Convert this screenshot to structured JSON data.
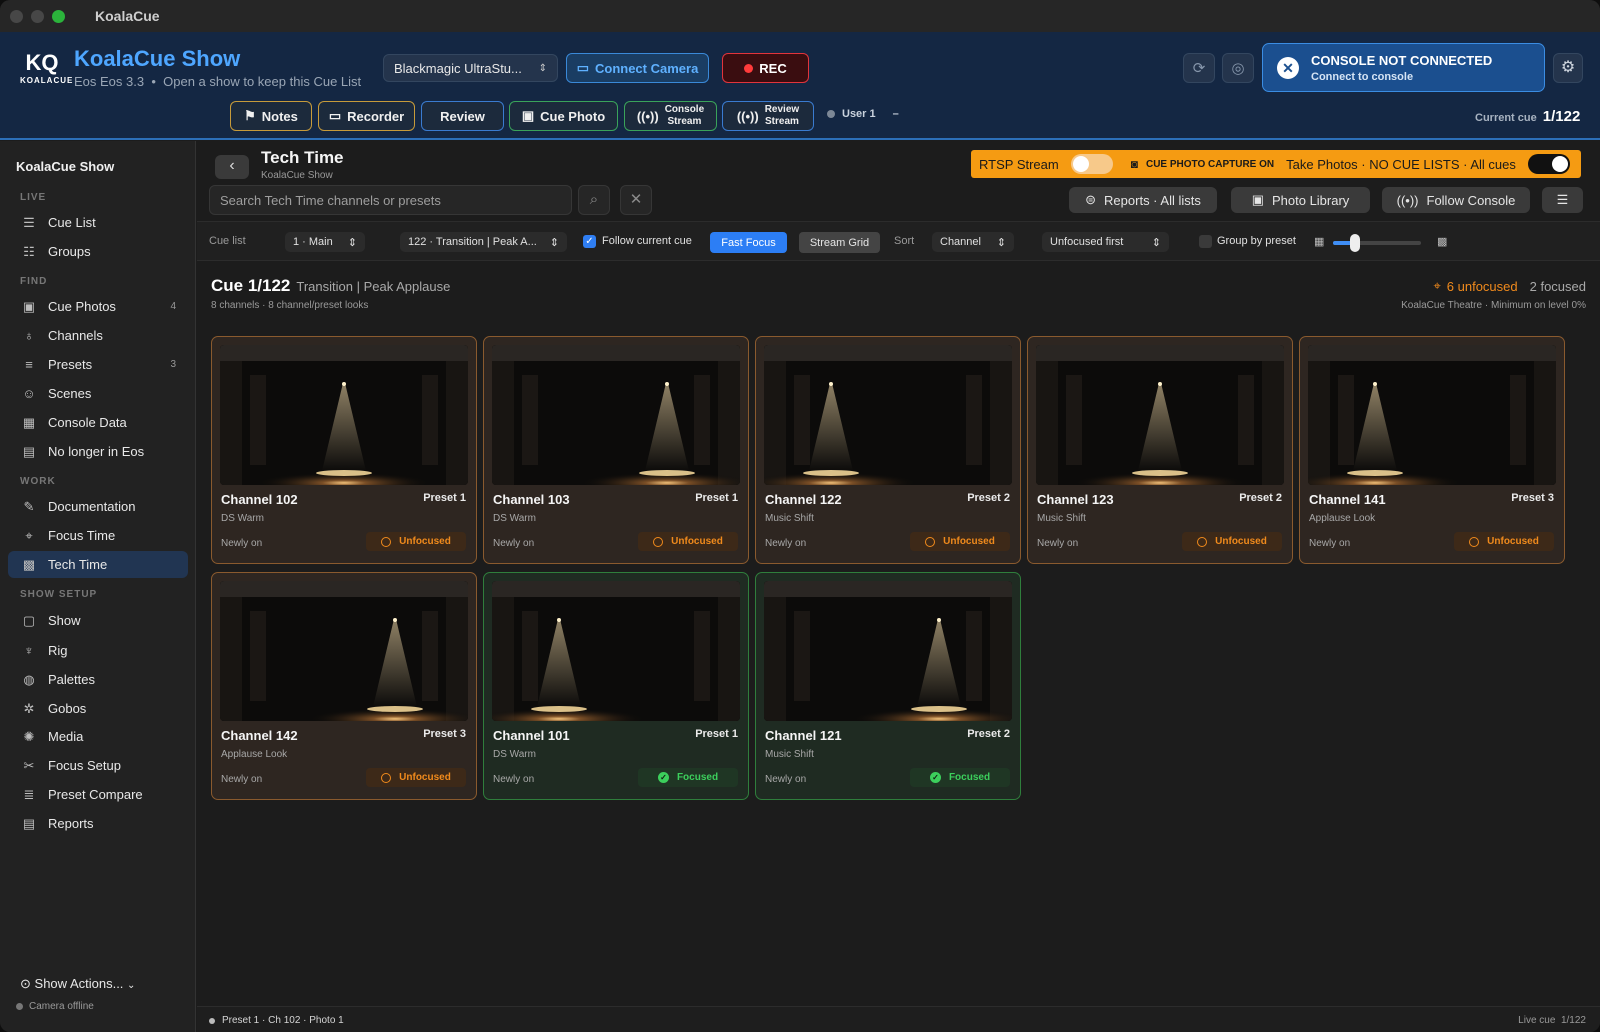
{
  "window": {
    "app_name": "KoalaCue"
  },
  "header": {
    "logo_text": "KQ",
    "logo_sub": "KOALACUE",
    "show_name": "KoalaCue Show",
    "subtitle_console": "Eos Eos 3.3",
    "subtitle_sep": "•",
    "subtitle_hint": "Open a show to keep this Cue List",
    "camera_select": "Blackmagic UltraStu...",
    "connect_camera": "Connect Camera",
    "rec": "REC",
    "console_title": "CONSOLE NOT CONNECTED",
    "console_sub": "Connect to console",
    "toolbar": {
      "notes": "Notes",
      "recorder": "Recorder",
      "review": "Review",
      "cue_photo": "Cue Photo",
      "console_stream_1": "Console",
      "console_stream_2": "Stream",
      "review_stream_1": "Review",
      "review_stream_2": "Stream"
    },
    "user": "User 1",
    "user_extra": "–",
    "current_cue_label": "Current cue",
    "current_cue_value": "1/122"
  },
  "sidebar": {
    "title": "KoalaCue Show",
    "sections": {
      "live": "LIVE",
      "find": "FIND",
      "work": "WORK",
      "show_setup": "SHOW SETUP"
    },
    "items": [
      {
        "label": "Cue List",
        "icon": "list-icon",
        "count": ""
      },
      {
        "label": "Groups",
        "icon": "people-icon",
        "count": ""
      },
      {
        "label": "Cue Photos",
        "icon": "photos-icon",
        "count": "4"
      },
      {
        "label": "Channels",
        "icon": "light-icon",
        "count": ""
      },
      {
        "label": "Presets",
        "icon": "sliders-icon",
        "count": "3"
      },
      {
        "label": "Scenes",
        "icon": "masks-icon",
        "count": ""
      },
      {
        "label": "Console Data",
        "icon": "table-icon",
        "count": ""
      },
      {
        "label": "No longer in Eos",
        "icon": "archive-icon",
        "count": ""
      },
      {
        "label": "Documentation",
        "icon": "edit-icon",
        "count": ""
      },
      {
        "label": "Focus Time",
        "icon": "crosshair-icon",
        "count": ""
      },
      {
        "label": "Tech Time",
        "icon": "grid-icon",
        "count": ""
      },
      {
        "label": "Show",
        "icon": "document-icon",
        "count": ""
      },
      {
        "label": "Rig",
        "icon": "lamp-icon",
        "count": ""
      },
      {
        "label": "Palettes",
        "icon": "palette-icon",
        "count": ""
      },
      {
        "label": "Gobos",
        "icon": "gobo-icon",
        "count": ""
      },
      {
        "label": "Media",
        "icon": "film-icon",
        "count": ""
      },
      {
        "label": "Focus Setup",
        "icon": "tools-icon",
        "count": ""
      },
      {
        "label": "Preset Compare",
        "icon": "compare-icon",
        "count": ""
      },
      {
        "label": "Reports",
        "icon": "report-icon",
        "count": ""
      }
    ],
    "show_actions": "Show Actions...",
    "camera_status": "Camera offline"
  },
  "page": {
    "title": "Tech Time",
    "subtitle": "KoalaCue Show",
    "rtsp_label": "RTSP Stream",
    "capture_label": "CUE PHOTO CAPTURE ON",
    "take_photos": "Take Photos · NO CUE LISTS · All cues",
    "search_placeholder": "Search Tech Time channels or presets",
    "reports_btn": "Reports · All lists",
    "photo_library": "Photo Library",
    "follow_console": "Follow Console"
  },
  "filters": {
    "cue_list_label": "Cue list",
    "cue_list_value": "1 · Main",
    "cue_value": "122 · Transition | Peak A...",
    "follow_current": "Follow current cue",
    "fast_focus": "Fast Focus",
    "stream_grid": "Stream Grid",
    "sort_label": "Sort",
    "sort_value": "Channel",
    "order_value": "Unfocused first",
    "group_by_preset": "Group by preset",
    "zoom_level": 0.25
  },
  "cue": {
    "title": "Cue 1/122",
    "name": "Transition | Peak Applause",
    "sub": "8 channels · 8 channel/preset looks",
    "unfocused": "6 unfocused",
    "focused": "2 focused",
    "venue": "KoalaCue Theatre · Minimum on level 0%"
  },
  "cards": [
    {
      "channel": "Channel 102",
      "preset": "Preset 1",
      "look": "DS Warm",
      "state": "Newly on",
      "status": "Unfocused",
      "focused": false
    },
    {
      "channel": "Channel 103",
      "preset": "Preset 1",
      "look": "DS Warm",
      "state": "Newly on",
      "status": "Unfocused",
      "focused": false
    },
    {
      "channel": "Channel 122",
      "preset": "Preset 2",
      "look": "Music Shift",
      "state": "Newly on",
      "status": "Unfocused",
      "focused": false
    },
    {
      "channel": "Channel 123",
      "preset": "Preset 2",
      "look": "Music Shift",
      "state": "Newly on",
      "status": "Unfocused",
      "focused": false
    },
    {
      "channel": "Channel 141",
      "preset": "Preset 3",
      "look": "Applause Look",
      "state": "Newly on",
      "status": "Unfocused",
      "focused": false
    },
    {
      "channel": "Channel 142",
      "preset": "Preset 3",
      "look": "Applause Look",
      "state": "Newly on",
      "status": "Unfocused",
      "focused": false
    },
    {
      "channel": "Channel 101",
      "preset": "Preset 1",
      "look": "DS Warm",
      "state": "Newly on",
      "status": "Focused",
      "focused": true
    },
    {
      "channel": "Channel 121",
      "preset": "Preset 2",
      "look": "Music Shift",
      "state": "Newly on",
      "status": "Focused",
      "focused": true
    }
  ],
  "statusbar": {
    "left": "Preset 1 · Ch 102 · Photo 1",
    "right_label": "Live cue",
    "right_value": "1/122"
  },
  "colors": {
    "accent": "#4ea6ff",
    "warning": "#f08a1c",
    "success": "#3ccf5c",
    "rtsp": "#f59b12",
    "rec": "#e2343c"
  }
}
